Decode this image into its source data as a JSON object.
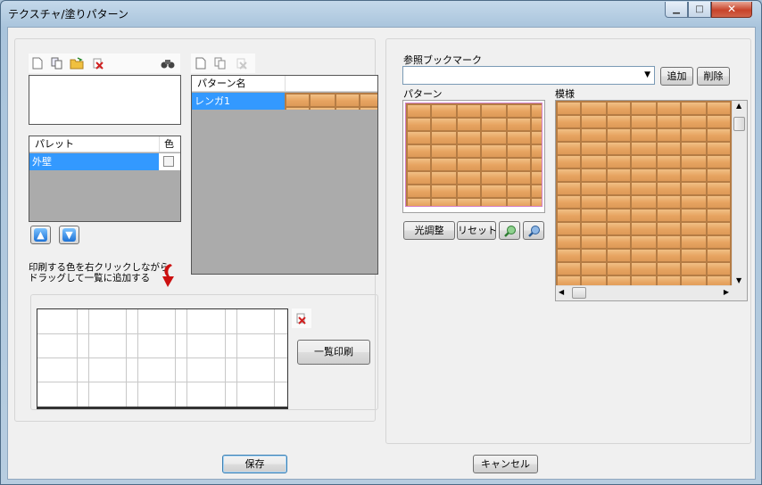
{
  "window": {
    "title": "テクスチャ/塗りパターン"
  },
  "palette": {
    "header_col1": "パレット",
    "header_col2": "色",
    "selected_item": "外壁"
  },
  "pattern_list": {
    "header": "パターン名",
    "selected_item": "レンガ1"
  },
  "instruction": {
    "line1": "印刷する色を右クリックしながら",
    "line2": "ドラッグして一覧に追加する"
  },
  "buttons": {
    "print_list": "一覧印刷",
    "add": "追加",
    "delete": "削除",
    "brightness": "光調整",
    "reset": "リセット",
    "save": "保存",
    "cancel": "キャンセル"
  },
  "bookmark": {
    "label": "参照ブックマーク",
    "value": ""
  },
  "preview": {
    "pattern_label": "パターン",
    "texture_label": "模様"
  },
  "icons": [
    "new-file-icon",
    "copy-icon",
    "open-folder-icon",
    "delete-x-icon",
    "binoculars-icon",
    "new-pattern-icon",
    "copy-pattern-icon",
    "delete-pattern-icon",
    "arrow-up-icon",
    "arrow-down-icon",
    "red-down-arrow-icon",
    "zoom-in-icon",
    "zoom-out-icon"
  ]
}
